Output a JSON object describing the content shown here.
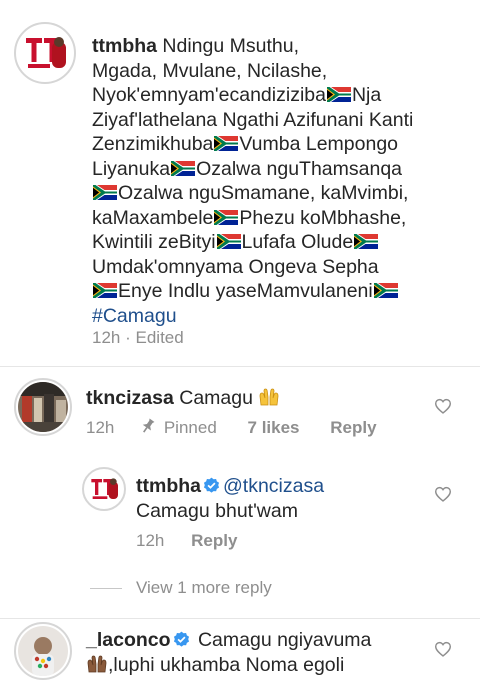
{
  "post": {
    "username": "ttmbha",
    "caption_segments": [
      "Ndingu Msuthu, ",
      "Mgada, Mvulane, Ncilashe, ",
      "Nyok'emnyam'ecandiziziba",
      "Nja ",
      "Ziyaf'lathelana Ngathi Azifunani Kanti ",
      "Zenzimikhuba",
      "Vumba Lempongo ",
      "Liyanuka",
      "Ozalwa nguThamsanqa ",
      "Ozalwa nguSmamane, kaMvimbi, ",
      "kaMaxambele",
      "Phezu koMbhashe, ",
      "Kwintili zeBityi",
      "Lufafa Olude",
      "Umdak'omnyama Ongeva Sepha",
      "Enye Indlu yaseMamvulaneni",
      "#Camagu"
    ],
    "time": "12h",
    "dot": "·",
    "edited": "Edited"
  },
  "comments": [
    {
      "username": "tkncizasa",
      "text": "Camagu",
      "emoji": "raised-hands",
      "time": "12h",
      "pinned": "Pinned",
      "likes": "7 likes",
      "reply": "Reply"
    },
    {
      "username": "ttmbha",
      "mention": "@tkncizasa",
      "text": "Camagu bhut'wam",
      "time": "12h",
      "reply": "Reply",
      "verified": true
    },
    {
      "username": "_laconco",
      "text_line1": "Camagu ngiyavuma",
      "text_line2": ",luphi ukhamba Noma egoli",
      "verified": true
    }
  ],
  "view_more": "View 1 more reply",
  "icons": {
    "heart": "heart-outline-icon",
    "pin": "pin-icon",
    "verified": "verified-badge-icon",
    "flag": "south-africa-flag-icon"
  },
  "colors": {
    "link": "#1f4f8c",
    "verified": "#3897f0",
    "meta": "#8e8e8e",
    "text": "#262626"
  }
}
